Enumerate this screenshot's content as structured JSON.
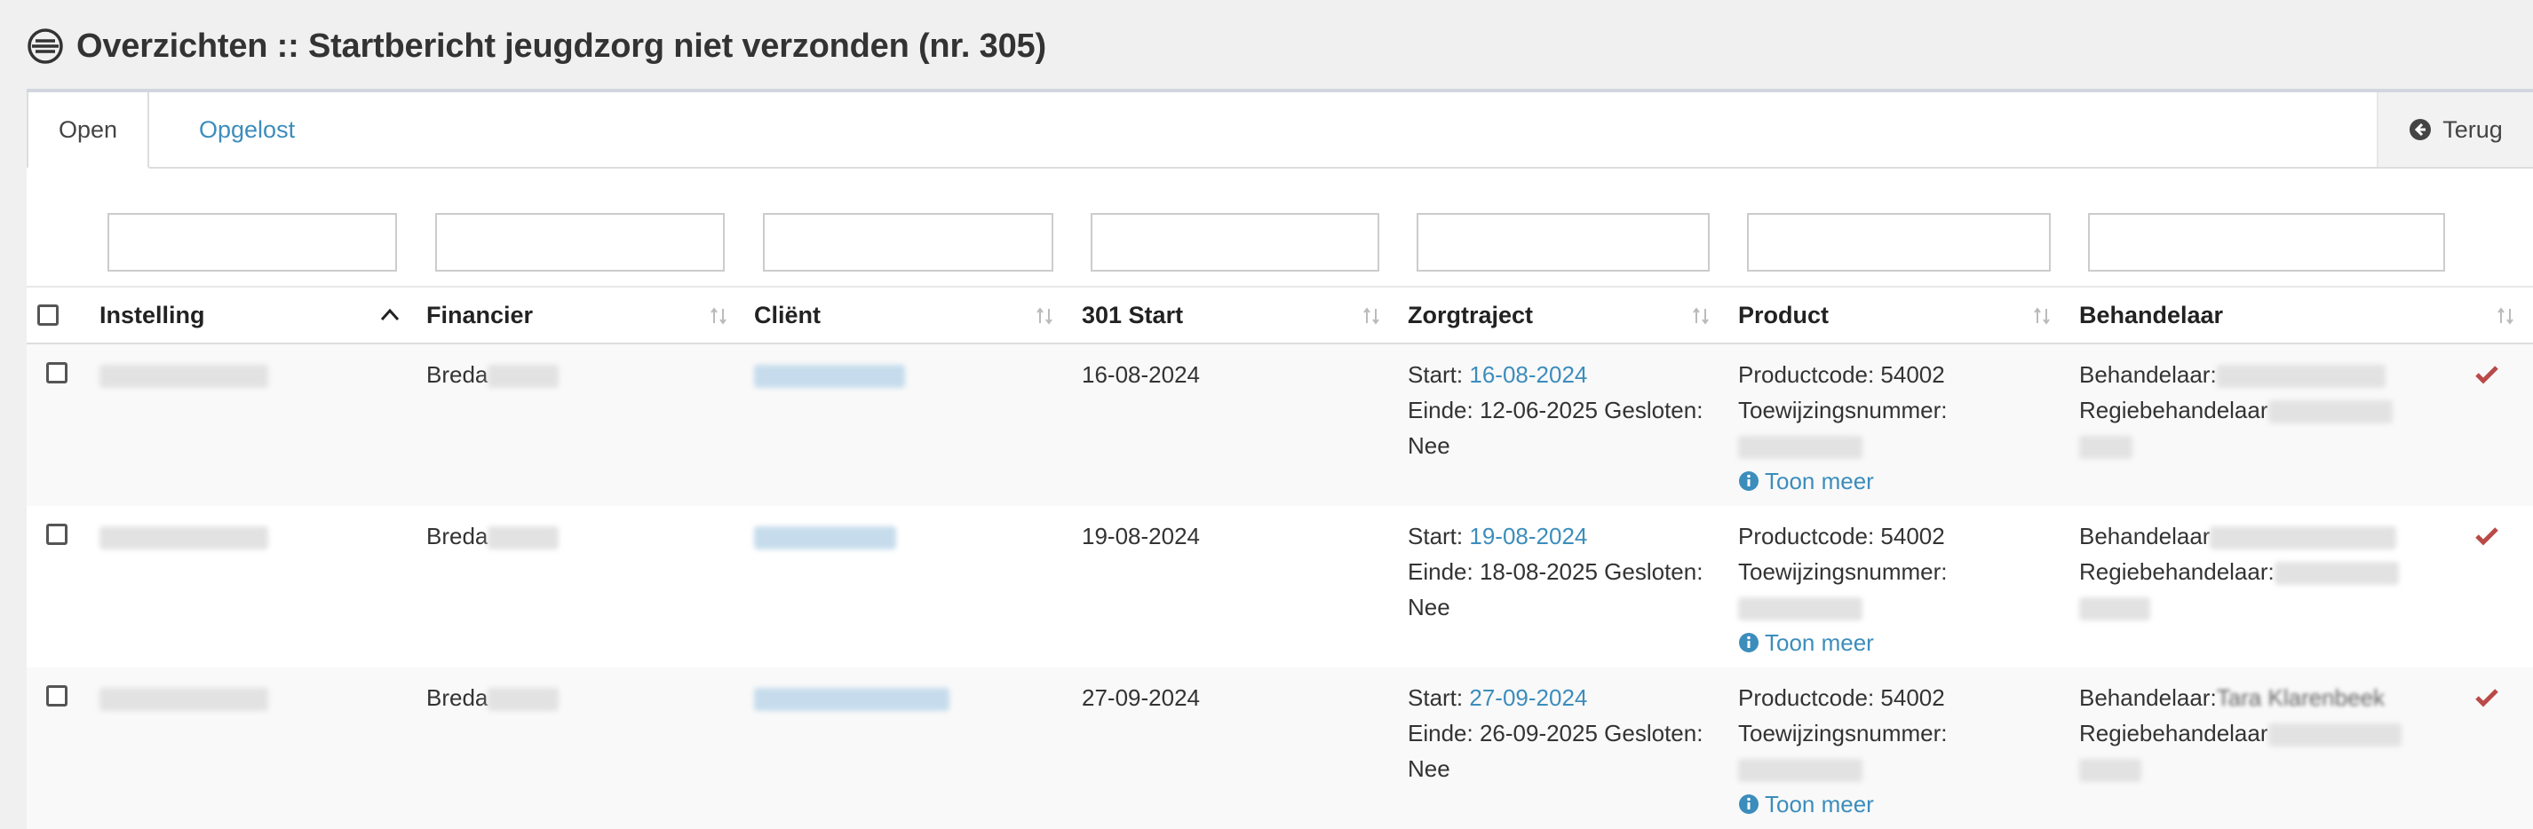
{
  "page": {
    "title": "Overzichten :: Startbericht jeugdzorg niet verzonden (nr. 305)",
    "title_icon": "list-circle-icon"
  },
  "tabs": [
    {
      "label": "Open",
      "active": true
    },
    {
      "label": "Opgelost",
      "active": false
    }
  ],
  "back_button": {
    "label": "Terug",
    "icon": "arrow-circle-left-icon"
  },
  "columns": [
    "Instelling",
    "Financier",
    "Cliënt",
    "301 Start",
    "Zorgtraject",
    "Product",
    "Behandelaar"
  ],
  "rows": [
    {
      "financier": "Breda",
      "start_301": "16-08-2024",
      "zorg_start_label": "Start:",
      "zorg_start_date": "16-08-2024",
      "zorg_einde": "Einde: 12-06-2025 Gesloten:",
      "zorg_gesloten": "Nee",
      "productcode": "Productcode: 54002",
      "toewijzing": "Toewijzingsnummer:",
      "toon_meer": "Toon meer",
      "behandelaar_label": "Behandelaar:",
      "behandelaar_name": "",
      "regie_label": "Regiebehandelaar"
    },
    {
      "financier": "Breda",
      "start_301": "19-08-2024",
      "zorg_start_label": "Start:",
      "zorg_start_date": "19-08-2024",
      "zorg_einde": "Einde: 18-08-2025 Gesloten:",
      "zorg_gesloten": "Nee",
      "productcode": "Productcode: 54002",
      "toewijzing": "Toewijzingsnummer:",
      "toon_meer": "Toon meer",
      "behandelaar_label": "Behandelaar",
      "behandelaar_name": "",
      "regie_label": "Regiebehandelaar:"
    },
    {
      "financier": "Breda",
      "start_301": "27-09-2024",
      "zorg_start_label": "Start:",
      "zorg_start_date": "27-09-2024",
      "zorg_einde": "Einde: 26-09-2025 Gesloten:",
      "zorg_gesloten": "Nee",
      "productcode": "Productcode: 54002",
      "toewijzing": "Toewijzingsnummer:",
      "toon_meer": "Toon meer",
      "behandelaar_label": "Behandelaar:",
      "behandelaar_name": "Tara Klarenbeek",
      "regie_label": "Regiebehandelaar"
    }
  ],
  "colors": {
    "link": "#3c8dbc",
    "check": "#b94a48",
    "panel_border": "#d2d6de",
    "background": "#f0f0f0"
  }
}
